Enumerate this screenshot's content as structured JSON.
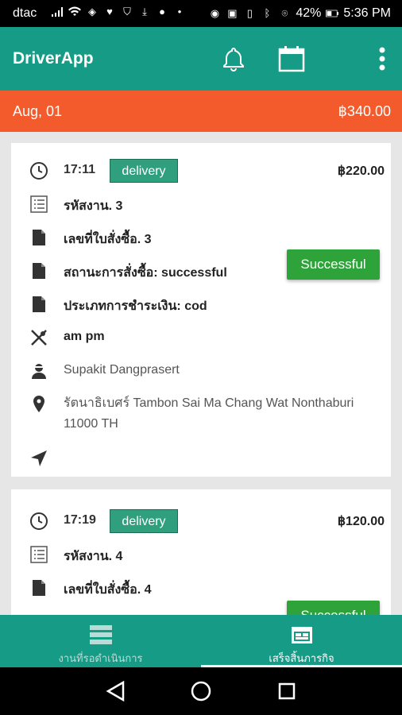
{
  "status_bar": {
    "carrier": "dtac",
    "battery": "42%",
    "time": "5:36 PM"
  },
  "app_bar": {
    "title": "DriverApp"
  },
  "date_header": {
    "date": "Aug, 01",
    "total": "฿340.00"
  },
  "orders": [
    {
      "time": "17:11",
      "type_badge": "delivery",
      "amount": "฿220.00",
      "job_code": "รหัสงาน. 3",
      "order_number": "เลขที่ใบสั่งซื้อ. 3",
      "order_status": "สถานะการสั่งซื้อ: successful",
      "status_button": "Successful",
      "payment_type": "ประเภทการชำระเงิน: cod",
      "restaurant": "am pm",
      "customer": "Supakit Dangprasert",
      "address": "รัตนาธิเบศร์ Tambon Sai Ma Chang Wat Nonthaburi 11000 TH"
    },
    {
      "time": "17:19",
      "type_badge": "delivery",
      "amount": "฿120.00",
      "job_code": "รหัสงาน. 4",
      "order_number": "เลขที่ใบสั่งซื้อ. 4",
      "status_button": "Successful"
    }
  ],
  "bottom_nav": {
    "tabs": [
      {
        "label": "งานที่รอดำเนินการ",
        "icon": "list-icon",
        "active": false
      },
      {
        "label": "เสร็จสิ้นภารกิจ",
        "icon": "calendar-check-icon",
        "active": true
      }
    ]
  },
  "colors": {
    "primary": "#169b87",
    "date_bar": "#f35b2c",
    "badge": "#2f9f7d",
    "success": "#2ea33a"
  }
}
